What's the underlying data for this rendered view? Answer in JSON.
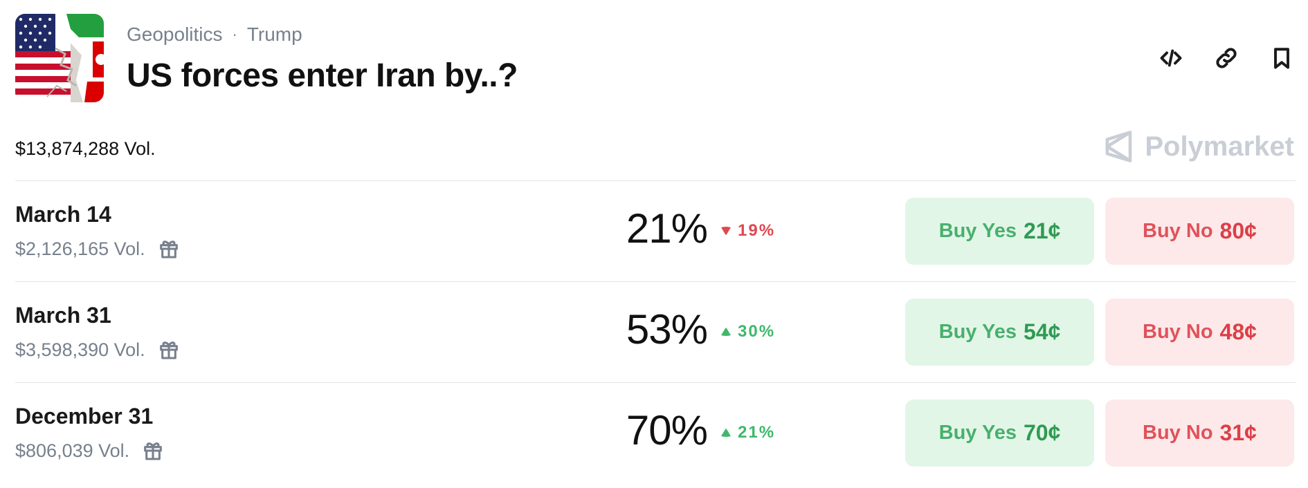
{
  "header": {
    "category": "Geopolitics",
    "separator": "·",
    "tag": "Trump",
    "title": "US forces enter Iran by..?"
  },
  "actions": [
    "embed-icon",
    "link-icon",
    "bookmark-icon"
  ],
  "total_volume": "$13,874,288 Vol.",
  "brand": "Polymarket",
  "colors": {
    "yes_bg": "#e2f6e8",
    "yes_text": "#48b06c",
    "no_bg": "#fde9ea",
    "no_text": "#e0525a",
    "up": "#3fb86a",
    "down": "#e0484f"
  },
  "markets": [
    {
      "name": "March 14",
      "volume": "$2,126,165 Vol.",
      "probability": "21%",
      "change": "19%",
      "direction": "down",
      "yes_label": "Buy Yes",
      "yes_price": "21¢",
      "no_label": "Buy No",
      "no_price": "80¢"
    },
    {
      "name": "March 31",
      "volume": "$3,598,390 Vol.",
      "probability": "53%",
      "change": "30%",
      "direction": "up",
      "yes_label": "Buy Yes",
      "yes_price": "54¢",
      "no_label": "Buy No",
      "no_price": "48¢"
    },
    {
      "name": "December 31",
      "volume": "$806,039 Vol.",
      "probability": "70%",
      "change": "21%",
      "direction": "up",
      "yes_label": "Buy Yes",
      "yes_price": "70¢",
      "no_label": "Buy No",
      "no_price": "31¢"
    }
  ]
}
